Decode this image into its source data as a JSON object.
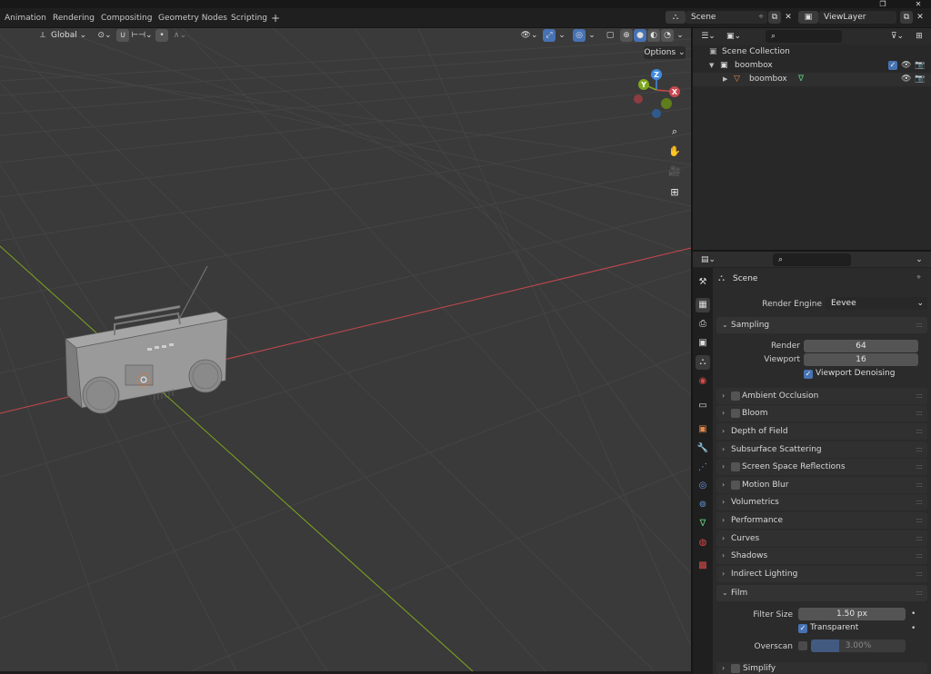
{
  "topbar": {
    "tabs": [
      "Animation",
      "Rendering",
      "Compositing",
      "Geometry Nodes",
      "Scripting"
    ],
    "add_tab": "+",
    "scene_label": "Scene",
    "view_layer_label": "ViewLayer"
  },
  "viewport": {
    "transform_orientation": "Global",
    "options_label": "Options",
    "gizmo_axes": {
      "z": "Z",
      "y": "Y",
      "x": "X"
    },
    "colors": {
      "x_axis": "#c8484f",
      "y_axis": "#7ea61f",
      "z_axis": "#3f8ce0",
      "bg": "#3a3a3a"
    }
  },
  "outliner": {
    "rows": [
      {
        "label": "Scene Collection"
      },
      {
        "label": "boombox"
      },
      {
        "label": "boombox"
      }
    ]
  },
  "properties": {
    "context_title": "Scene",
    "render_engine_label": "Render Engine",
    "render_engine_value": "Eevee",
    "sampling": {
      "title": "Sampling",
      "render_label": "Render",
      "render_value": "64",
      "viewport_label": "Viewport",
      "viewport_value": "16",
      "denoise_label": "Viewport Denoising"
    },
    "panels": [
      {
        "title": "Ambient Occlusion",
        "checkbox": true
      },
      {
        "title": "Bloom",
        "checkbox": true
      },
      {
        "title": "Depth of Field",
        "checkbox": false
      },
      {
        "title": "Subsurface Scattering",
        "checkbox": false
      },
      {
        "title": "Screen Space Reflections",
        "checkbox": true
      },
      {
        "title": "Motion Blur",
        "checkbox": true
      },
      {
        "title": "Volumetrics",
        "checkbox": false
      },
      {
        "title": "Performance",
        "checkbox": false
      },
      {
        "title": "Curves",
        "checkbox": false
      },
      {
        "title": "Shadows",
        "checkbox": false
      },
      {
        "title": "Indirect Lighting",
        "checkbox": false
      }
    ],
    "film": {
      "title": "Film",
      "filter_size_label": "Filter Size",
      "filter_size_value": "1.50 px",
      "transparent_label": "Transparent",
      "overscan_label": "Overscan",
      "overscan_value": "3.00%",
      "overscan_fill": 0.3
    },
    "simplify": {
      "title": "Simplify"
    }
  }
}
